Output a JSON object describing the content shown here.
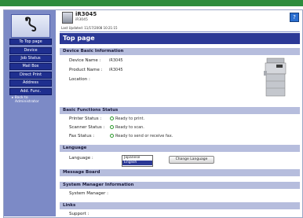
{
  "header": {
    "model": "iR3045",
    "model_sub": "iR3045",
    "last_updated": "Last Updated: 11/17/2008 10:21:15",
    "help_label": "?"
  },
  "sidebar": {
    "top_page": "To Top page",
    "items": [
      {
        "label": "Device"
      },
      {
        "label": "Job Status"
      },
      {
        "label": "Mail Box"
      },
      {
        "label": "Direct Print"
      },
      {
        "label": "Address"
      },
      {
        "label": "Add. Func."
      }
    ],
    "link_line1": "Back to",
    "link_line2": "Administrator"
  },
  "page": {
    "title": "Top page"
  },
  "device_info": {
    "heading": "Device Basic Information",
    "device_name_label": "Device Name :",
    "device_name": "iR3045",
    "product_name_label": "Product Name :",
    "product_name": "iR3045",
    "location_label": "Location :"
  },
  "functions": {
    "heading": "Basic Functions Status",
    "printer_label": "Printer Status :",
    "printer_status": "Ready to print.",
    "scanner_label": "Scanner Status :",
    "scanner_status": "Ready to scan.",
    "fax_label": "Fax Status :",
    "fax_status": "Ready to send or receive fax."
  },
  "language": {
    "heading": "Language",
    "label": "Language :",
    "options": [
      "Japanese",
      "English"
    ],
    "selected": "English",
    "button": "Change Language"
  },
  "message_board": {
    "heading": "Message Board"
  },
  "system_manager": {
    "heading": "System Manager Information",
    "label": "System Manager :"
  },
  "links": {
    "heading": "Links",
    "support_label": "Support :"
  },
  "colors": {
    "accent": "#2b3896",
    "sidebar": "#7c8ac6",
    "section": "#b6bddd",
    "status_ok": "#2e9a2e",
    "top_stripe": "#2d8c3c"
  }
}
